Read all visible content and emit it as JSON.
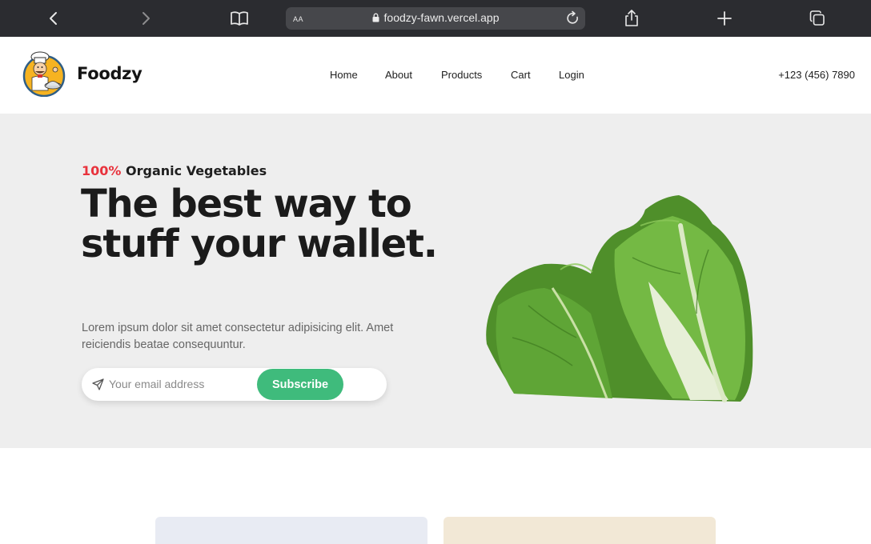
{
  "browser": {
    "url": "foodzy-fawn.vercel.app",
    "reader_label": "AA",
    "icons": [
      "back-icon",
      "forward-icon",
      "bookmarks-icon",
      "lock-icon",
      "reload-icon",
      "share-icon",
      "new-tab-icon",
      "tabs-icon"
    ],
    "colors": {
      "toolbar": "#2b2c30",
      "address_bar": "#46474b"
    }
  },
  "header": {
    "brand": "Foodzy",
    "nav": [
      "Home",
      "About",
      "Products",
      "Cart",
      "Login"
    ],
    "phone": "+123 (456) 7890"
  },
  "hero": {
    "eyebrow_accent": "100%",
    "eyebrow_text": "Organic Vegetables",
    "headline": "The best way to stuff your wallet.",
    "lead": "Lorem ipsum dolor sit amet consectetur adipisicing elit. Amet reiciendis beatae consequuntur.",
    "email_placeholder": "Your email address",
    "subscribe_label": "Subscribe",
    "colors": {
      "accent": "#e8323c",
      "button": "#3fbb7c",
      "background": "#eeeeee"
    }
  },
  "cards": {
    "colors": [
      "#e8ebf3",
      "#f2e8d6"
    ]
  }
}
